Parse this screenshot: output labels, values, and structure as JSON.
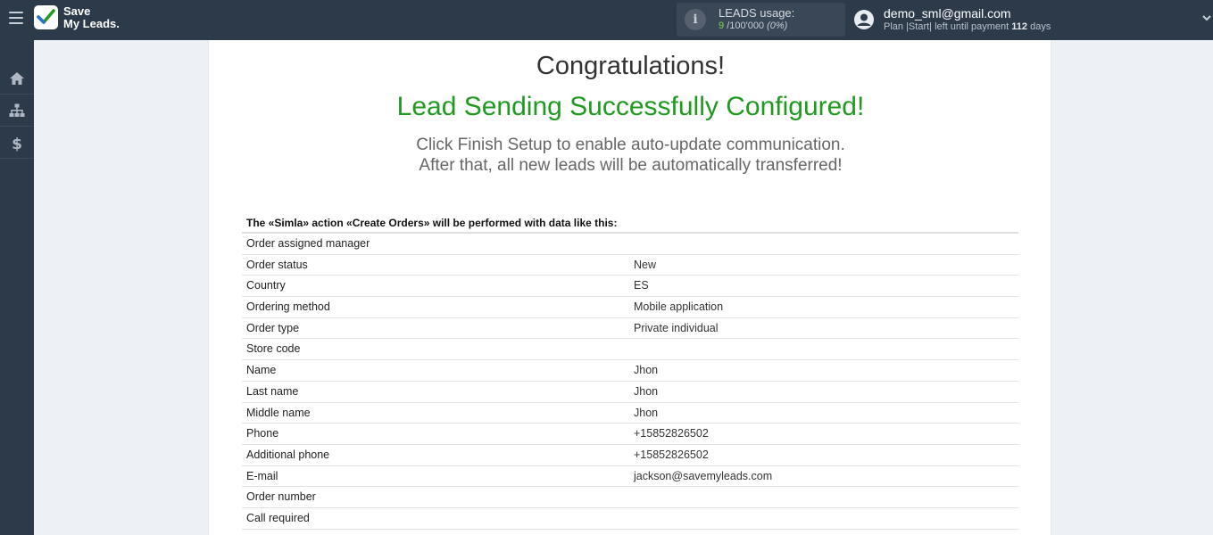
{
  "app": {
    "logo_line1": "Save",
    "logo_line2": "My Leads."
  },
  "usage": {
    "title": "LEADS usage:",
    "used": "9",
    "total": "/100'000",
    "percent": "(0%)"
  },
  "user": {
    "email": "demo_sml@gmail.com",
    "plan_prefix": "Plan |Start| left until payment",
    "days": "112",
    "days_suffix": "days"
  },
  "sidebar": {
    "items": [
      "home-icon",
      "sitemap-icon",
      "dollar-icon"
    ]
  },
  "main": {
    "congrats": "Congratulations!",
    "success": "Lead Sending Successfully Configured!",
    "hint_line1": "Click Finish Setup to enable auto-update communication.",
    "hint_line2": "After that, all new leads will be automatically transferred!",
    "table_caption": "The «Simla» action «Create Orders» will be performed with data like this:",
    "rows": [
      {
        "key": "Order assigned manager",
        "value": ""
      },
      {
        "key": "Order status",
        "value": "New"
      },
      {
        "key": "Country",
        "value": "ES"
      },
      {
        "key": "Ordering method",
        "value": "Mobile application"
      },
      {
        "key": "Order type",
        "value": "Private individual"
      },
      {
        "key": "Store code",
        "value": ""
      },
      {
        "key": "Name",
        "value": "Jhon"
      },
      {
        "key": "Last name",
        "value": "Jhon"
      },
      {
        "key": "Middle name",
        "value": "Jhon"
      },
      {
        "key": "Phone",
        "value": "+15852826502"
      },
      {
        "key": "Additional phone",
        "value": "+15852826502"
      },
      {
        "key": "E-mail",
        "value": "jackson@savemyleads.com"
      },
      {
        "key": "Order number",
        "value": ""
      },
      {
        "key": "Call required",
        "value": ""
      }
    ]
  },
  "colors": {
    "topbar": "#2d3a4a",
    "success_green": "#1f9a1f",
    "usage_green": "#7fd35b"
  }
}
